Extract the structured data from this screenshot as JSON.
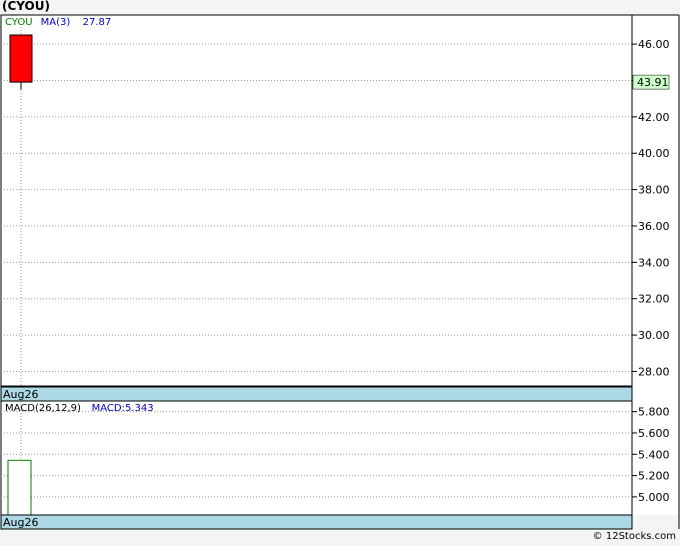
{
  "page": {
    "title": "(CYOU)",
    "footer": "© 12Stocks.com"
  },
  "colors": {
    "down_candle": "#ff0000",
    "ma_line": "#0000cc",
    "macd_bar": "#008000",
    "date_bar": "#add8e6",
    "last_price_bg": "#ccffcc",
    "grid": "#999999"
  },
  "chart_data": [
    {
      "type": "candlestick",
      "legend": [
        {
          "label": "CYOU",
          "color": "#008000"
        },
        {
          "label": "MA(3)",
          "color": "#0000cc"
        },
        {
          "label": "27.87",
          "color": "#0000cc"
        }
      ],
      "x": [
        "Aug26"
      ],
      "candles": [
        {
          "date": "Aug26",
          "open": 46.5,
          "high": 46.5,
          "low": 43.5,
          "close": 43.91
        }
      ],
      "last_price": "43.91",
      "ylim": [
        27.2,
        47.6
      ],
      "yticks": [
        "46.00",
        "44.00",
        "42.00",
        "40.00",
        "38.00",
        "36.00",
        "34.00",
        "32.00",
        "30.00",
        "28.00"
      ],
      "ytick_values": [
        46,
        44,
        42,
        40,
        38,
        36,
        34,
        32,
        30,
        28
      ],
      "date_label": "Aug26"
    },
    {
      "type": "bar",
      "legend": [
        {
          "label": "MACD(26,12,9)",
          "color": "#000000"
        },
        {
          "label": "MACD:5.343",
          "color": "#0000cc"
        }
      ],
      "x": [
        "Aug26"
      ],
      "values": [
        5.343
      ],
      "ylim": [
        4.83,
        5.9
      ],
      "yticks": [
        "5.800",
        "5.600",
        "5.400",
        "5.200",
        "5.000"
      ],
      "ytick_values": [
        5.8,
        5.6,
        5.4,
        5.2,
        5.0
      ],
      "date_label": "Aug26"
    }
  ]
}
